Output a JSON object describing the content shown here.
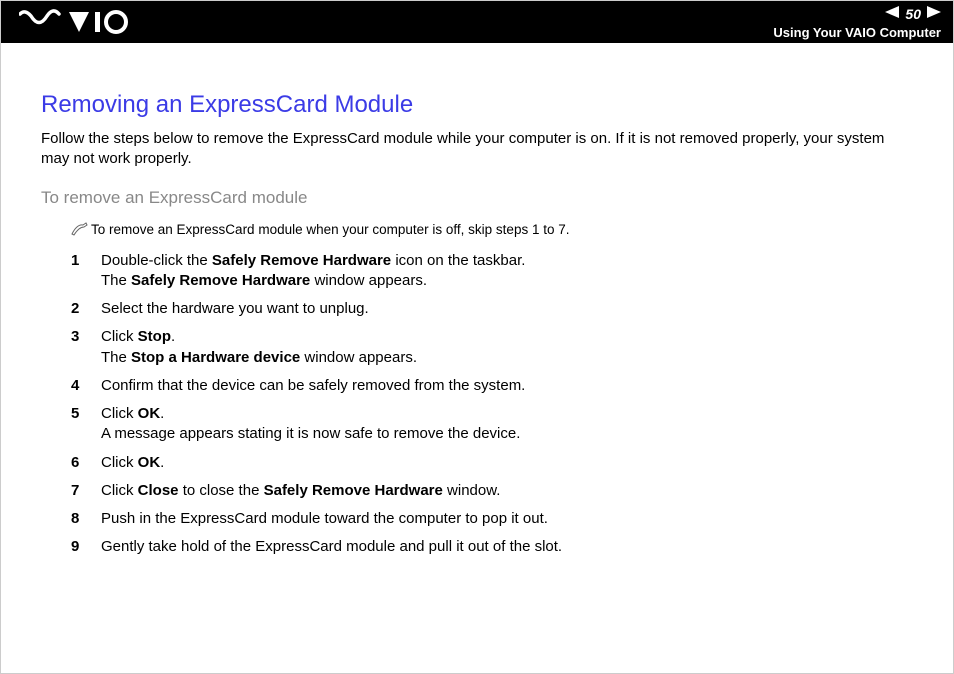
{
  "header": {
    "page_number": "50",
    "section": "Using Your VAIO Computer"
  },
  "title": "Removing an ExpressCard Module",
  "intro": "Follow the steps below to remove the ExpressCard module while your computer is on. If it is not removed properly, your system may not work properly.",
  "subhead": "To remove an ExpressCard module",
  "note": "To remove an ExpressCard module when your computer is off, skip steps 1 to 7.",
  "steps": [
    {
      "n": "1",
      "parts": [
        "Double-click the ",
        {
          "b": "Safely Remove Hardware"
        },
        " icon on the taskbar.\nThe ",
        {
          "b": "Safely Remove Hardware"
        },
        " window appears."
      ]
    },
    {
      "n": "2",
      "parts": [
        "Select the hardware you want to unplug."
      ]
    },
    {
      "n": "3",
      "parts": [
        "Click ",
        {
          "b": "Stop"
        },
        ".\nThe ",
        {
          "b": "Stop a Hardware device"
        },
        " window appears."
      ]
    },
    {
      "n": "4",
      "parts": [
        "Confirm that the device can be safely removed from the system."
      ]
    },
    {
      "n": "5",
      "parts": [
        "Click ",
        {
          "b": "OK"
        },
        ".\nA message appears stating it is now safe to remove the device."
      ]
    },
    {
      "n": "6",
      "parts": [
        "Click ",
        {
          "b": "OK"
        },
        "."
      ]
    },
    {
      "n": "7",
      "parts": [
        "Click ",
        {
          "b": "Close"
        },
        " to close the ",
        {
          "b": "Safely Remove Hardware"
        },
        " window."
      ]
    },
    {
      "n": "8",
      "parts": [
        "Push in the ExpressCard module toward the computer to pop it out."
      ]
    },
    {
      "n": "9",
      "parts": [
        "Gently take hold of the ExpressCard module and pull it out of the slot."
      ]
    }
  ]
}
